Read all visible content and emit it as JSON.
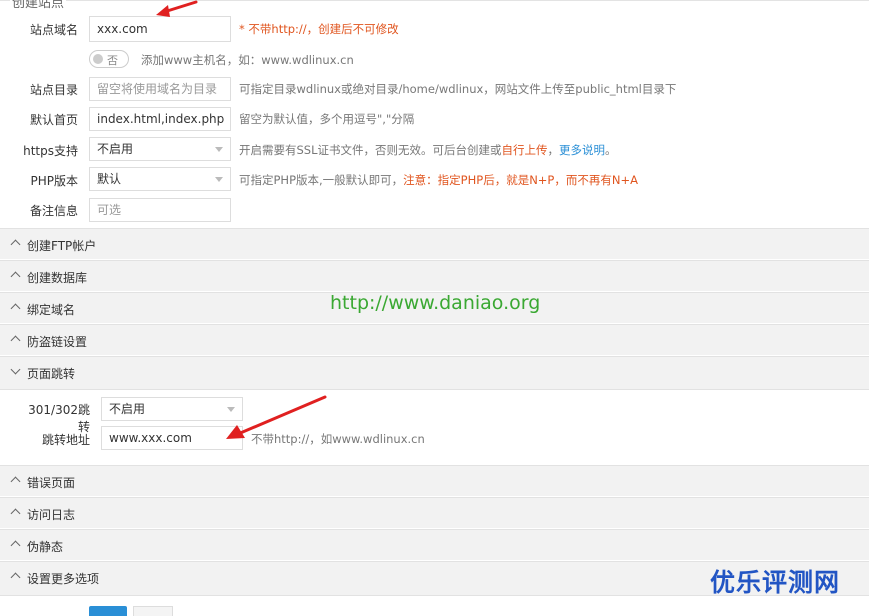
{
  "section_title": "创建站点",
  "form": {
    "domain": {
      "label": "站点域名",
      "value": "xxx.com",
      "hint": "* 不带http://，创建后不可修改"
    },
    "www_toggle": {
      "state_label": "否",
      "hint": "添加www主机名，如：www.wdlinux.cn"
    },
    "site_dir": {
      "label": "站点目录",
      "placeholder": "留空将使用域名为目录",
      "hint": "可指定目录wdlinux或绝对目录/home/wdlinux，网站文件上传至public_html目录下"
    },
    "index_page": {
      "label": "默认首页",
      "value": "index.html,index.php",
      "hint": "留空为默认值，多个用逗号\",\"分隔"
    },
    "https": {
      "label": "https支持",
      "selected": "不启用",
      "hint_prefix": "开启需要有SSL证书文件，否则无效。可后台创建或",
      "hint_red": "自行上传",
      "hint_mid": "，",
      "hint_blue": "更多说明",
      "hint_end": "。"
    },
    "php": {
      "label": "PHP版本",
      "selected": "默认",
      "hint_prefix": "可指定PHP版本,一般默认即可，",
      "hint_red": "注意：指定PHP后，就是N+P，而不再有N+A"
    },
    "note": {
      "label": "备注信息",
      "placeholder": "可选"
    }
  },
  "sections_top": [
    {
      "label": "创建FTP帐户",
      "expanded": false
    },
    {
      "label": "创建数据库",
      "expanded": false
    },
    {
      "label": "绑定域名",
      "expanded": false
    },
    {
      "label": "防盗链设置",
      "expanded": false
    },
    {
      "label": "页面跳转",
      "expanded": true
    }
  ],
  "redirect": {
    "type": {
      "label": "301/302跳转",
      "selected": "不启用"
    },
    "url": {
      "label": "跳转地址",
      "value": "www.xxx.com",
      "hint": "不带http://，如www.wdlinux.cn"
    }
  },
  "sections_bottom": [
    {
      "label": "错误页面",
      "expanded": false
    },
    {
      "label": "访问日志",
      "expanded": false
    },
    {
      "label": "伪静态",
      "expanded": false
    },
    {
      "label": "设置更多选项",
      "expanded": false
    }
  ],
  "watermark_url": "http://www.daniao.org",
  "brand_watermark": "优乐评测网",
  "colors": {
    "accent_red": "#e0551f",
    "link_blue": "#2a8fd6",
    "watermark_green": "#3aa832",
    "brand_blue": "#2255c4",
    "arrow_red": "#e02020"
  }
}
